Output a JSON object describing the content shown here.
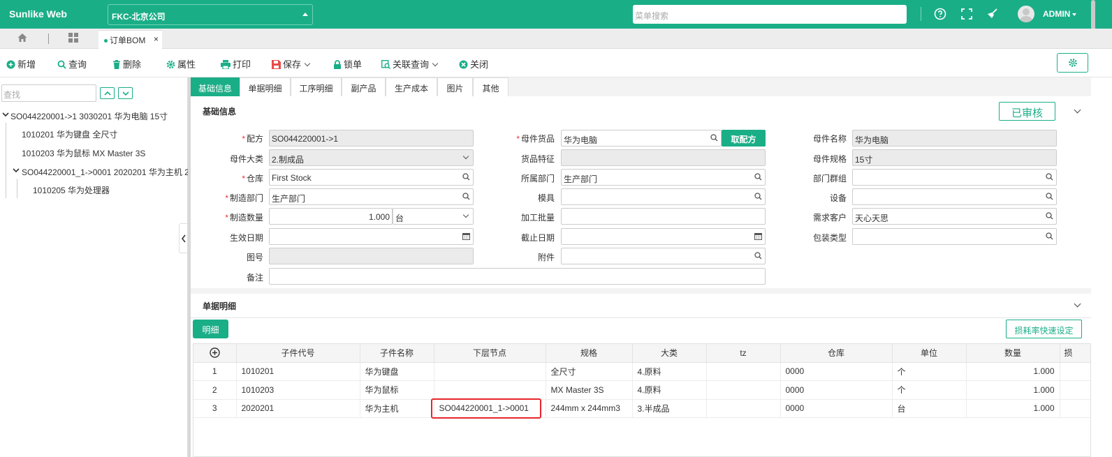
{
  "app": {
    "brand": "Sunlike Web",
    "company": "FKC-北京公司",
    "search_placeholder": "菜单搜索",
    "user": "ADMIN"
  },
  "doc_tab": {
    "label": "订单BOM",
    "close": "×"
  },
  "toolbar": {
    "new": "新增",
    "query": "查询",
    "delete": "删除",
    "props": "属性",
    "print": "打印",
    "save": "保存",
    "lock": "锁单",
    "related": "关联查询",
    "close": "关闭"
  },
  "tree": {
    "search_placeholder": "查找",
    "nodes": [
      "SO044220001->1 3030201 华为电脑 15寸",
      "1010201 华为键盘 全尺寸",
      "1010203 华为鼠标 MX Master 3S",
      "SO044220001_1->0001 2020201 华为主机 2",
      "1010205 华为处理器"
    ]
  },
  "tabs": [
    "基础信息",
    "单据明细",
    "工序明细",
    "副产品",
    "生产成本",
    "图片",
    "其他"
  ],
  "basic": {
    "section_title": "基础信息",
    "status": "已审核",
    "pick_button": "取配方",
    "labels": {
      "formula": "配方",
      "parent_goods": "母件货品",
      "parent_name": "母件名称",
      "parent_category": "母件大类",
      "goods_feature": "货品特征",
      "parent_spec": "母件规格",
      "warehouse": "仓库",
      "owner_dept": "所属部门",
      "dept_group": "部门群组",
      "mfg_dept": "制造部门",
      "mold": "模具",
      "equipment": "设备",
      "mfg_qty": "制造数量",
      "batch": "加工批量",
      "customer": "需求客户",
      "eff_date": "生效日期",
      "end_date": "截止日期",
      "pack_type": "包装类型",
      "drawing": "图号",
      "attachment": "附件",
      "remark": "备注"
    },
    "values": {
      "formula": "SO044220001->1",
      "parent_goods": "华为电脑",
      "parent_name": "华为电脑",
      "parent_category": "2.制成品",
      "parent_spec": "15寸",
      "warehouse": "First Stock",
      "owner_dept": "生产部门",
      "mfg_dept": "生产部门",
      "mfg_qty": "1.000",
      "unit": "台",
      "customer": "天心天思"
    }
  },
  "detail": {
    "section_title": "单据明细",
    "tab_button": "明细",
    "loss_button": "损耗率快速设定",
    "columns": [
      "子件代号",
      "子件名称",
      "下层节点",
      "规格",
      "大类",
      "tz",
      "仓库",
      "单位",
      "数量",
      "损"
    ],
    "rows": [
      {
        "no": "1",
        "code": "1010201",
        "name": "华为键盘",
        "node": "",
        "spec": "全尺寸",
        "cat": "4.原料",
        "tz": "",
        "wh": "0000",
        "unit": "个",
        "qty": "1.000"
      },
      {
        "no": "2",
        "code": "1010203",
        "name": "华为鼠标",
        "node": "",
        "spec": "MX Master 3S",
        "cat": "4.原料",
        "tz": "",
        "wh": "0000",
        "unit": "个",
        "qty": "1.000"
      },
      {
        "no": "3",
        "code": "2020201",
        "name": "华为主机",
        "node": "SO044220001_1->0001",
        "spec": "244mm x 244mm3",
        "cat": "3.半成品",
        "tz": "",
        "wh": "0000",
        "unit": "台",
        "qty": "1.000"
      }
    ]
  },
  "colors": {
    "accent": "#1aae87",
    "highlight": "#e6262a"
  }
}
